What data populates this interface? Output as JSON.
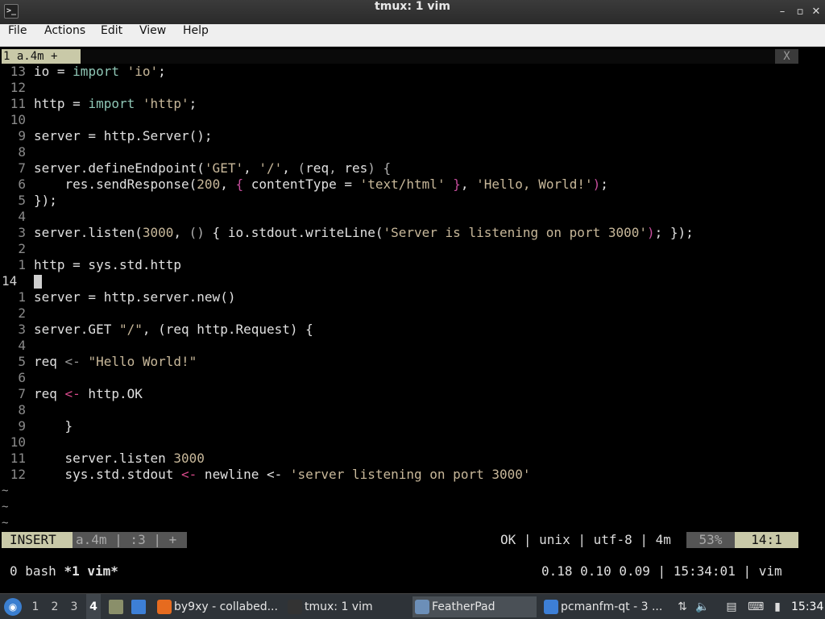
{
  "window": {
    "title": "tmux: 1 vim",
    "app_icon_glyph": ">_"
  },
  "window_buttons": {
    "minimize": "–",
    "maximize": "✕",
    "restore": "▫"
  },
  "menu": [
    "File",
    "Actions",
    "Edit",
    "View",
    "Help"
  ],
  "vim_tab": {
    "label": "1 a.4m +",
    "close": "X"
  },
  "lines": [
    {
      "n": "13",
      "code": [
        {
          "t": "io = "
        },
        {
          "t": "import",
          "c": "kw"
        },
        {
          "t": " "
        },
        {
          "t": "'io'",
          "c": "str"
        },
        {
          "t": ";"
        }
      ]
    },
    {
      "n": "12",
      "code": []
    },
    {
      "n": "11",
      "code": [
        {
          "t": "http = "
        },
        {
          "t": "import",
          "c": "kw"
        },
        {
          "t": " "
        },
        {
          "t": "'http'",
          "c": "str"
        },
        {
          "t": ";"
        }
      ]
    },
    {
      "n": "10",
      "code": []
    },
    {
      "n": "9",
      "code": [
        {
          "t": "server = http.Server();"
        }
      ]
    },
    {
      "n": "8",
      "code": []
    },
    {
      "n": "7",
      "code": [
        {
          "t": "server.defineEndpoint("
        },
        {
          "t": "'GET'",
          "c": "str"
        },
        {
          "t": ", "
        },
        {
          "t": "'/'",
          "c": "str"
        },
        {
          "t": ", "
        },
        {
          "t": "(",
          "c": "dim"
        },
        {
          "t": "req"
        },
        {
          "t": ",",
          "c": "dim"
        },
        {
          "t": " res"
        },
        {
          "t": ")",
          "c": "dim"
        },
        {
          "t": " "
        },
        {
          "t": "{",
          "c": "dim"
        }
      ]
    },
    {
      "n": "6",
      "code": [
        {
          "t": "    res.sendResponse("
        },
        {
          "t": "200",
          "c": "num"
        },
        {
          "t": ", "
        },
        {
          "t": "{",
          "c": "paren"
        },
        {
          "t": " contentType = "
        },
        {
          "t": "'text/html'",
          "c": "str"
        },
        {
          "t": " "
        },
        {
          "t": "}",
          "c": "paren"
        },
        {
          "t": ", "
        },
        {
          "t": "'Hello, World!'",
          "c": "str"
        },
        {
          "t": ")",
          "c": "paren"
        },
        {
          "t": ";"
        }
      ]
    },
    {
      "n": "5",
      "code": [
        {
          "t": "});"
        }
      ]
    },
    {
      "n": "4",
      "code": []
    },
    {
      "n": "3",
      "code": [
        {
          "t": "server.listen("
        },
        {
          "t": "3000",
          "c": "num"
        },
        {
          "t": ", "
        },
        {
          "t": "()",
          "c": "dim"
        },
        {
          "t": " { io.stdout.writeLine("
        },
        {
          "t": "'Server is listening on port 3000'",
          "c": "str"
        },
        {
          "t": ")",
          "c": "paren"
        },
        {
          "t": "; });"
        }
      ]
    },
    {
      "n": "2",
      "code": []
    },
    {
      "n": "1",
      "code": [
        {
          "t": "http = sys.std.http"
        }
      ]
    },
    {
      "n": "14",
      "current": true,
      "code": []
    },
    {
      "n": "1",
      "code": [
        {
          "t": "server = http.server.new()"
        }
      ]
    },
    {
      "n": "2",
      "code": []
    },
    {
      "n": "3",
      "code": [
        {
          "t": "server.GET "
        },
        {
          "t": "\"/\"",
          "c": "str"
        },
        {
          "t": ", (req http.Request) {"
        }
      ]
    },
    {
      "n": "4",
      "code": []
    },
    {
      "n": "5",
      "code": [
        {
          "t": "req "
        },
        {
          "t": "<-",
          "c": "op"
        },
        {
          "t": " "
        },
        {
          "t": "\"Hello World!\"",
          "c": "str"
        }
      ]
    },
    {
      "n": "6",
      "code": []
    },
    {
      "n": "7",
      "code": [
        {
          "t": "req "
        },
        {
          "t": "<-",
          "c": "arrow"
        },
        {
          "t": " http.OK"
        }
      ]
    },
    {
      "n": "8",
      "code": []
    },
    {
      "n": "9",
      "code": [
        {
          "t": "    }"
        }
      ]
    },
    {
      "n": "10",
      "code": []
    },
    {
      "n": "11",
      "code": [
        {
          "t": "    server.listen "
        },
        {
          "t": "3000",
          "c": "num"
        }
      ]
    },
    {
      "n": "12",
      "code": [
        {
          "t": "    sys.std.stdout "
        },
        {
          "t": "<-",
          "c": "arrow"
        },
        {
          "t": " newline <- "
        },
        {
          "t": "'server listening on port 3000'",
          "c": "str"
        }
      ]
    }
  ],
  "tildes": [
    "~",
    "~",
    "~"
  ],
  "vim_status": {
    "mode": "INSERT",
    "branch": "a.4m | :3 | +",
    "right": "OK | unix | utf-8 | 4m",
    "percent": "53%",
    "position": "14:1"
  },
  "tmux_status": {
    "windows_prefix": "0 bash ",
    "active_window": "*1 vim*",
    "right": "0.18 0.10 0.09 | 15:34:01 | vim"
  },
  "taskbar": {
    "workspaces": [
      "1",
      "2",
      "3",
      "4"
    ],
    "active_workspace": "4",
    "tasks": [
      {
        "label": "by9xy - collabed...",
        "icon_color": "#e66b1f",
        "icon": "firefox-icon"
      },
      {
        "label": "tmux: 1 vim",
        "icon_color": "#333333",
        "icon": "terminal-icon"
      },
      {
        "label": "FeatherPad",
        "icon_color": "#6c8fb8",
        "icon": "featherpad-icon",
        "active": true
      },
      {
        "label": "pcmanfm-qt - 3 ...",
        "icon_color": "#3d7fd6",
        "icon": "folder-icon"
      }
    ],
    "clock": "15:34"
  }
}
